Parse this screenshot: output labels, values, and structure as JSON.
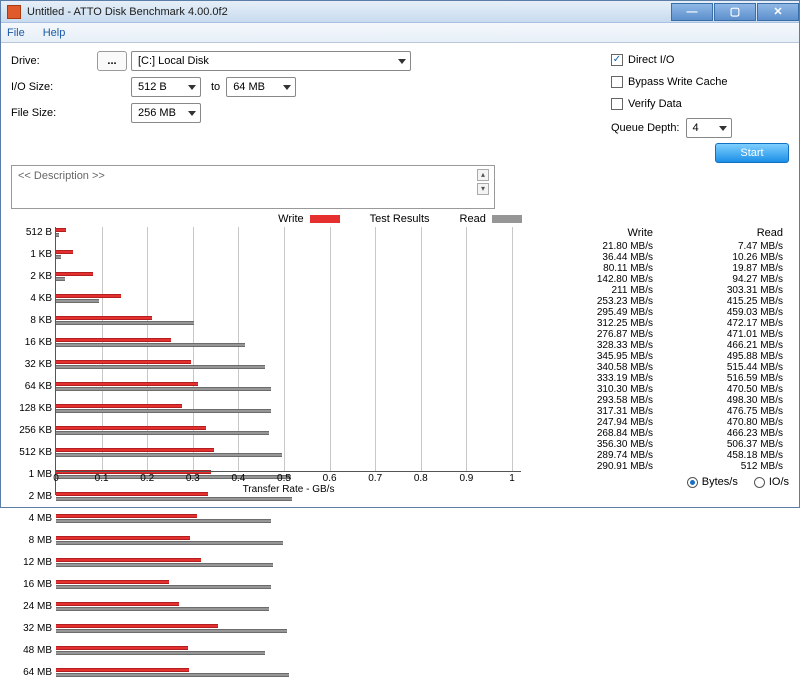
{
  "window": {
    "title": "Untitled - ATTO Disk Benchmark 4.00.0f2"
  },
  "menubar": {
    "file": "File",
    "help": "Help"
  },
  "form": {
    "drive_label": "Drive:",
    "drive_value": "[C:] Local Disk",
    "ellipsis": "...",
    "iosize_label": "I/O Size:",
    "iosize_from": "512 B",
    "iosize_to_label": "to",
    "iosize_to": "64 MB",
    "filesize_label": "File Size:",
    "filesize_value": "256 MB"
  },
  "options": {
    "direct_io": "Direct I/O",
    "bypass": "Bypass Write Cache",
    "verify": "Verify Data",
    "queue_depth_label": "Queue Depth:",
    "queue_depth_value": "4"
  },
  "start_label": "Start",
  "description_placeholder": "<< Description >>",
  "results": {
    "title": "Test Results",
    "legend_write": "Write",
    "legend_read": "Read",
    "xaxis_label": "Transfer Rate - GB/s",
    "xticks": [
      "0",
      "0.1",
      "0.2",
      "0.3",
      "0.4",
      "0.5",
      "0.6",
      "0.7",
      "0.8",
      "0.9",
      "1"
    ],
    "table_head_write": "Write",
    "table_head_read": "Read"
  },
  "unit_labels": {
    "bytes": "Bytes/s",
    "io": "IO/s"
  },
  "unit_suffix": "MB/s",
  "chart_data": {
    "type": "bar",
    "xlabel": "Transfer Rate - GB/s",
    "ylabel": "",
    "xlim": [
      0,
      1
    ],
    "categories": [
      "512 B",
      "1 KB",
      "2 KB",
      "4 KB",
      "8 KB",
      "16 KB",
      "32 KB",
      "64 KB",
      "128 KB",
      "256 KB",
      "512 KB",
      "1 MB",
      "2 MB",
      "4 MB",
      "8 MB",
      "12 MB",
      "16 MB",
      "24 MB",
      "32 MB",
      "48 MB",
      "64 MB"
    ],
    "series": [
      {
        "name": "Write",
        "values": [
          21.8,
          36.44,
          80.11,
          142.8,
          211,
          253.23,
          295.49,
          312.25,
          276.87,
          328.33,
          345.95,
          340.58,
          333.19,
          310.3,
          293.58,
          317.31,
          247.94,
          268.84,
          356.3,
          289.74,
          290.91
        ]
      },
      {
        "name": "Read",
        "values": [
          7.47,
          10.26,
          19.87,
          94.27,
          303.31,
          415.25,
          459.03,
          472.17,
          471.01,
          466.21,
          495.88,
          515.44,
          516.59,
          470.5,
          498.3,
          476.75,
          470.8,
          466.23,
          506.37,
          458.18,
          512
        ]
      }
    ]
  }
}
